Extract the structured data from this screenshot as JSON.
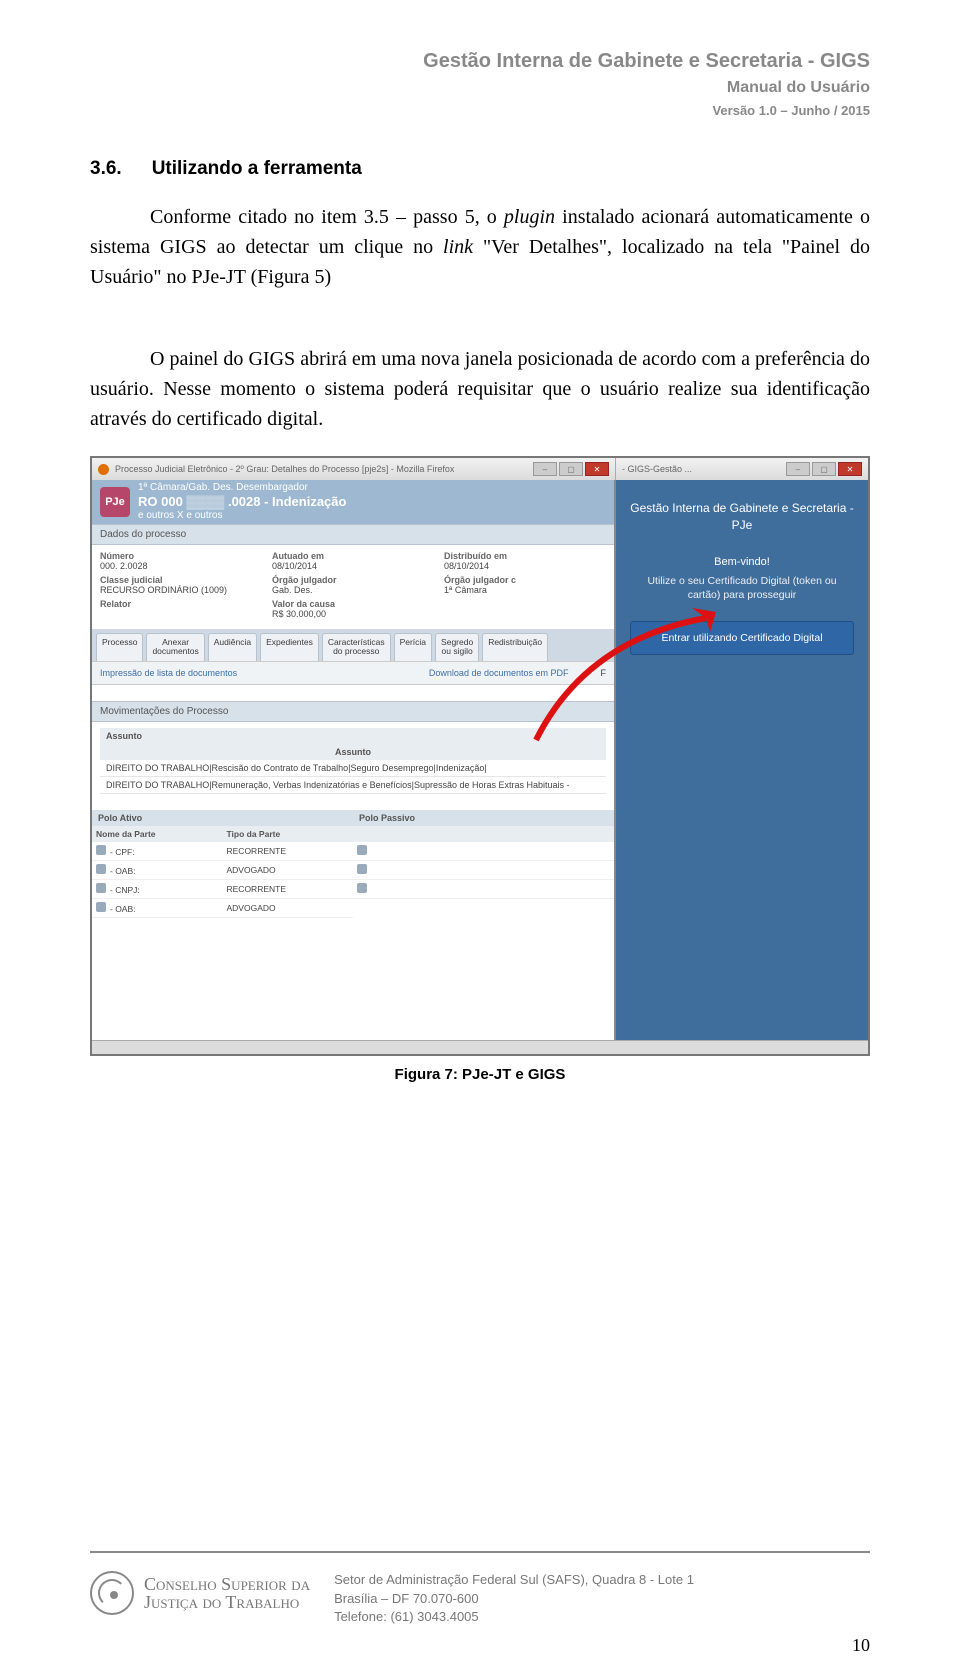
{
  "header": {
    "title": "Gestão Interna de Gabinete e Secretaria - GIGS",
    "subtitle": "Manual do Usuário",
    "version": "Versão 1.0 – Junho / 2015"
  },
  "section": {
    "num": "3.6.",
    "title": "Utilizando a ferramenta"
  },
  "para1_a": "Conforme citado no item 3.5 – passo 5, o ",
  "para1_b": "plugin",
  "para1_c": " instalado acionará automaticamente o sistema GIGS ao detectar um clique no ",
  "para1_d": "link",
  "para1_e": " \"Ver Detalhes\", localizado na tela \"Painel do Usuário\" no PJe-JT (Figura 5)",
  "para2": "O painel do GIGS abrirá em uma nova janela posicionada de acordo com a preferência do usuário. Nesse momento o sistema poderá requisitar que o usuário realize sua identificação através do certificado digital.",
  "figure_caption": "Figura 7: PJe-JT e GIGS",
  "shot": {
    "left_title": "Processo Judicial Eletrônico - 2º Grau: Detalhes do Processo [pje2s] - Mozilla Firefox",
    "right_title": "- GIGS-Gestão ...",
    "pje": {
      "logo": "PJe",
      "line1": "1ª Câmara/Gab. Des.          Desembargador",
      "line2_a": "RO 000",
      "line2_b": ".0028 - Indenização",
      "line3": "e outros X              e outros",
      "hdr1": "Dados do processo",
      "fields": {
        "f1l": "Número",
        "f1v": "000.              2.0028",
        "f2l": "Autuado em",
        "f2v": "08/10/2014",
        "f3l": "Distribuído em",
        "f3v": "08/10/2014",
        "f4l": "Classe judicial",
        "f4v": "RECURSO ORDINÁRIO (1009)",
        "f5l": "Órgão julgador",
        "f5v": "Gab. Des.",
        "f6l": "Órgão julgador c",
        "f6v": "1ª Câmara",
        "f7l": "Relator",
        "f7v": "",
        "f8l": "Valor da causa",
        "f8v": "R$ 30.000,00"
      },
      "tabs": [
        "Processo",
        "Anexar\ndocumentos",
        "Audiência",
        "Expedientes",
        "Características\ndo processo",
        "Perícia",
        "Segredo\nou sigilo",
        "Redistribuição"
      ],
      "links": [
        "Impressão de lista de documentos",
        "Download de documentos em PDF"
      ],
      "hdr2": "Movimentações do Processo",
      "th": "Assunto",
      "th2": "Assunto",
      "rows": [
        "DIREITO DO TRABALHO|Rescisão do Contrato de Trabalho|Seguro Desemprego|Indenização|",
        "DIREITO DO TRABALHO|Remuneração, Verbas Indenizatórias e Benefícios|Supressão de Horas Extras Habituais -"
      ],
      "polo_a": "Polo Ativo",
      "polo_p": "Polo Passivo",
      "pt_h1": "Nome da Parte",
      "pt_h2": "Tipo da Parte",
      "parts": [
        {
          "n": "- CPF:",
          "t": "RECORRENTE"
        },
        {
          "n": "- OAB:",
          "t": "ADVOGADO"
        },
        {
          "n": "- CNPJ:",
          "t": "RECORRENTE"
        },
        {
          "n": "- OAB:",
          "t": "ADVOGADO"
        }
      ]
    },
    "gigs": {
      "t1": "Gestão Interna de Gabinete e Secretaria - PJe",
      "t2": "Bem-vindo!",
      "t3": "Utilize o seu Certificado Digital (token ou cartão) para prosseguir",
      "btn": "Entrar utilizando Certificado Digital"
    }
  },
  "footer": {
    "org1": "Conselho Superior da",
    "org2": "Justiça do Trabalho",
    "addr1": "Setor de Administração Federal Sul (SAFS), Quadra 8 - Lote 1",
    "addr2": "Brasília – DF 70.070-600",
    "addr3": "Telefone: (61) 3043.4005",
    "page": "10"
  }
}
